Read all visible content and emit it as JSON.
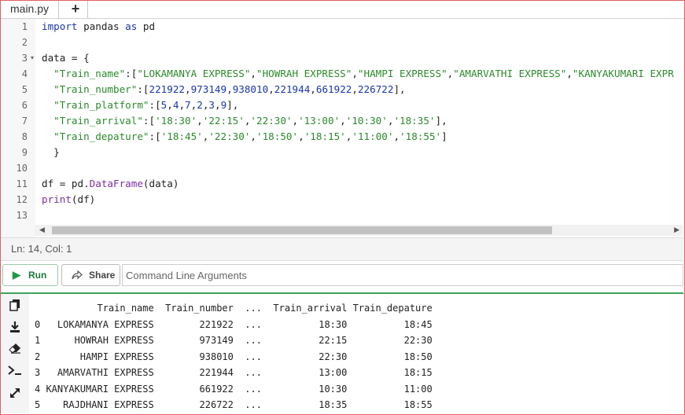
{
  "tabs": [
    {
      "label": "main.py"
    }
  ],
  "add_tab_label": "+",
  "code_lines": [
    {
      "n": "1",
      "segs": [
        {
          "t": "import",
          "c": "kw"
        },
        {
          "t": " pandas "
        },
        {
          "t": "as",
          "c": "kw"
        },
        {
          "t": " pd"
        }
      ]
    },
    {
      "n": "2",
      "segs": []
    },
    {
      "n": "3",
      "fold": true,
      "segs": [
        {
          "t": "data = {"
        }
      ]
    },
    {
      "n": "4",
      "segs": [
        {
          "t": "  "
        },
        {
          "t": "\"Train_name\"",
          "c": "str"
        },
        {
          "t": ":["
        },
        {
          "t": "\"LOKAMANYA EXPRESS\"",
          "c": "str"
        },
        {
          "t": ","
        },
        {
          "t": "\"HOWRAH EXPRESS\"",
          "c": "str"
        },
        {
          "t": ","
        },
        {
          "t": "\"HAMPI EXPRESS\"",
          "c": "str"
        },
        {
          "t": ","
        },
        {
          "t": "\"AMARVATHI EXPRESS\"",
          "c": "str"
        },
        {
          "t": ","
        },
        {
          "t": "\"KANYAKUMARI EXPR",
          "c": "str"
        }
      ]
    },
    {
      "n": "5",
      "segs": [
        {
          "t": "  "
        },
        {
          "t": "\"Train_number\"",
          "c": "str"
        },
        {
          "t": ":["
        },
        {
          "t": "221922",
          "c": "num"
        },
        {
          "t": ","
        },
        {
          "t": "973149",
          "c": "num"
        },
        {
          "t": ","
        },
        {
          "t": "938010",
          "c": "num"
        },
        {
          "t": ","
        },
        {
          "t": "221944",
          "c": "num"
        },
        {
          "t": ","
        },
        {
          "t": "661922",
          "c": "num"
        },
        {
          "t": ","
        },
        {
          "t": "226722",
          "c": "num"
        },
        {
          "t": "],"
        }
      ]
    },
    {
      "n": "6",
      "segs": [
        {
          "t": "  "
        },
        {
          "t": "\"Train_platform\"",
          "c": "str"
        },
        {
          "t": ":["
        },
        {
          "t": "5",
          "c": "num"
        },
        {
          "t": ","
        },
        {
          "t": "4",
          "c": "num"
        },
        {
          "t": ","
        },
        {
          "t": "7",
          "c": "num"
        },
        {
          "t": ","
        },
        {
          "t": "2",
          "c": "num"
        },
        {
          "t": ","
        },
        {
          "t": "3",
          "c": "num"
        },
        {
          "t": ","
        },
        {
          "t": "9",
          "c": "num"
        },
        {
          "t": "],"
        }
      ]
    },
    {
      "n": "7",
      "segs": [
        {
          "t": "  "
        },
        {
          "t": "\"Train_arrival\"",
          "c": "str"
        },
        {
          "t": ":["
        },
        {
          "t": "'18:30'",
          "c": "str"
        },
        {
          "t": ","
        },
        {
          "t": "'22:15'",
          "c": "str"
        },
        {
          "t": ","
        },
        {
          "t": "'22:30'",
          "c": "str"
        },
        {
          "t": ","
        },
        {
          "t": "'13:00'",
          "c": "str"
        },
        {
          "t": ","
        },
        {
          "t": "'10:30'",
          "c": "str"
        },
        {
          "t": ","
        },
        {
          "t": "'18:35'",
          "c": "str"
        },
        {
          "t": "],"
        }
      ]
    },
    {
      "n": "8",
      "segs": [
        {
          "t": "  "
        },
        {
          "t": "\"Train_depature\"",
          "c": "str"
        },
        {
          "t": ":["
        },
        {
          "t": "'18:45'",
          "c": "str"
        },
        {
          "t": ","
        },
        {
          "t": "'22:30'",
          "c": "str"
        },
        {
          "t": ","
        },
        {
          "t": "'18:50'",
          "c": "str"
        },
        {
          "t": ","
        },
        {
          "t": "'18:15'",
          "c": "str"
        },
        {
          "t": ","
        },
        {
          "t": "'11:00'",
          "c": "str"
        },
        {
          "t": ","
        },
        {
          "t": "'18:55'",
          "c": "str"
        },
        {
          "t": "]"
        }
      ]
    },
    {
      "n": "9",
      "segs": [
        {
          "t": "  }"
        }
      ]
    },
    {
      "n": "10",
      "segs": []
    },
    {
      "n": "11",
      "segs": [
        {
          "t": "df = pd."
        },
        {
          "t": "DataFrame",
          "c": "fn"
        },
        {
          "t": "(data)"
        }
      ]
    },
    {
      "n": "12",
      "segs": [
        {
          "t": "print",
          "c": "fn"
        },
        {
          "t": "(df)"
        }
      ]
    },
    {
      "n": "13",
      "segs": []
    }
  ],
  "status": {
    "position": "Ln: 14,  Col: 1"
  },
  "toolbar": {
    "run_label": "Run",
    "share_label": "Share",
    "cla_placeholder": "Command Line Arguments"
  },
  "sidebar_icons": [
    "copy-icon",
    "download-icon",
    "eraser-icon",
    "terminal-icon",
    "expand-icon"
  ],
  "output_lines": [
    "           Train_name  Train_number  ...  Train_arrival Train_depature",
    "0   LOKAMANYA EXPRESS        221922  ...          18:30          18:45",
    "1      HOWRAH EXPRESS        973149  ...          22:15          22:30",
    "2       HAMPI EXPRESS        938010  ...          22:30          18:50",
    "3   AMARVATHI EXPRESS        221944  ...          13:00          18:15",
    "4 KANYAKUMARI EXPRESS        661922  ...          10:30          11:00",
    "5    RAJDHANI EXPRESS        226722  ...          18:35          18:55"
  ]
}
